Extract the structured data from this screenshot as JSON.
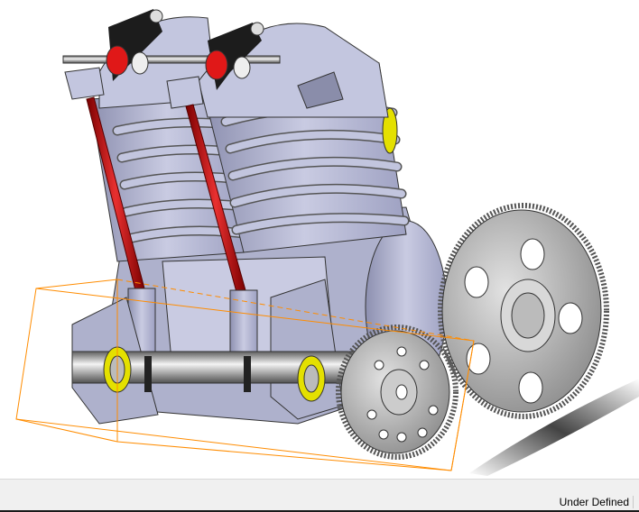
{
  "status_bar": {
    "status_text": "Under Defined"
  },
  "colors": {
    "part_body": "#b9bcd6",
    "pushrod": "#c8141a",
    "bushing": "#e4e000",
    "gear": "#9a9a9a",
    "bounding_box": "#ff8c00"
  }
}
